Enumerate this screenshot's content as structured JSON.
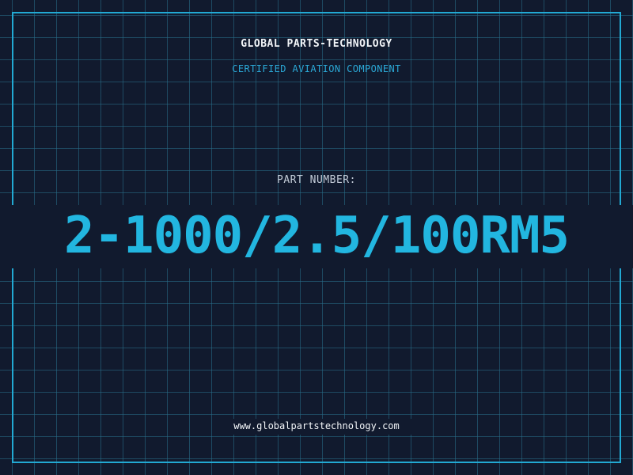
{
  "header": {
    "brand": "GLOBAL PARTS-TECHNOLOGY",
    "tagline": "CERTIFIED AVIATION COMPONENT"
  },
  "part": {
    "label": "PART NUMBER:",
    "number": "2-1000/2.5/100RM5"
  },
  "footer": {
    "website": "www.globalpartstechnology.com"
  },
  "colors": {
    "background": "#111a2e",
    "grid": "#29708c",
    "frame": "#22a9d3",
    "accent": "#22b6e0",
    "text_light": "#f2f5f8",
    "text_muted": "#c3ccd8"
  }
}
